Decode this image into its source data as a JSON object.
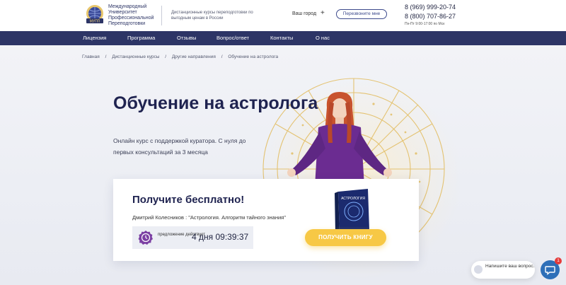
{
  "header": {
    "logo_text": "Международный Университет Профессиональной Переподготовки",
    "logo_badge": "МУПП",
    "tagline": "Дистанционные курсы переподготовки по выгодным ценам в России",
    "city_label": "Ваш город",
    "city_plus": "+",
    "callback_label": "Перезвоните мне",
    "phone_primary": "8 (969) 999-20-74",
    "phone_secondary": "8 (800) 707-86-27",
    "hours": "Пн-Пт 9:00-17:00 по Мск"
  },
  "nav": {
    "items": [
      {
        "label": "Лицензия"
      },
      {
        "label": "Программа"
      },
      {
        "label": "Отзывы"
      },
      {
        "label": "Вопрос/ответ"
      },
      {
        "label": "Контакты"
      },
      {
        "label": "О нас"
      }
    ]
  },
  "breadcrumbs": [
    {
      "label": "Главная"
    },
    {
      "label": "/"
    },
    {
      "label": "Дистанционные курсы"
    },
    {
      "label": "/"
    },
    {
      "label": "Другие направления"
    },
    {
      "label": "/"
    },
    {
      "label": "Обучение на астролога"
    }
  ],
  "hero": {
    "title": "Обучение на астролога",
    "subtitle": "Онлайн курс с поддержкой куратора. С нуля до первых консультаций за 3 месяца"
  },
  "offer": {
    "title": "Получите бесплатно!",
    "author": "Дмитрий Колесников : \"Астрология. Алгоритм тайного знания\"",
    "timer_label": "предложение действует",
    "timer_value": "4 дня 09:39:37",
    "book_cover_text": "АСТРОЛОГИЯ",
    "button_label": "ПОЛУЧИТЬ КНИГУ"
  },
  "chat": {
    "prompt": "Напишите ваш вопрос.",
    "badge_count": "1"
  },
  "colors": {
    "navy": "#2d3566",
    "accent_yellow": "#f7c845",
    "hero_bg": "#f2f3f7",
    "title": "#1f2350",
    "purple": "#6b2c91",
    "chat_blue": "#2e6fb8"
  },
  "icons": [
    "globe-logo-icon",
    "plus-icon",
    "clock-icon",
    "chat-icon"
  ]
}
